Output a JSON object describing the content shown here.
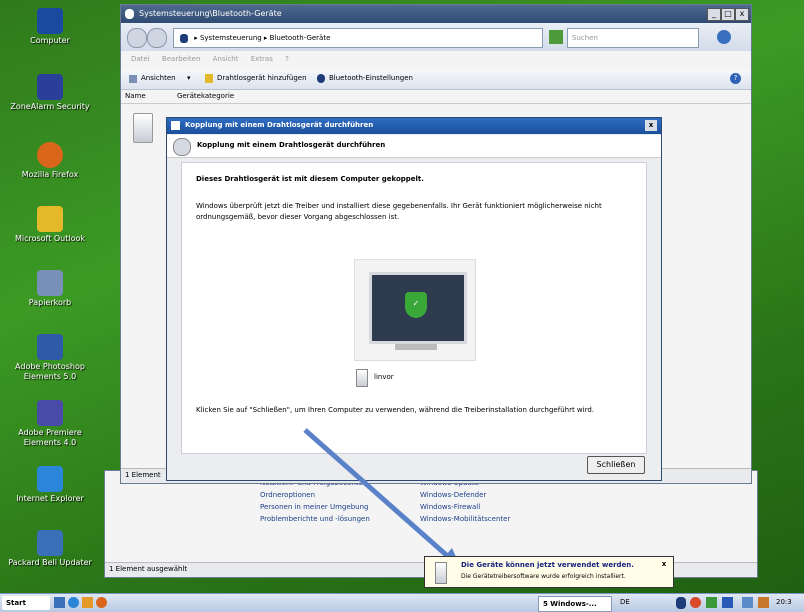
{
  "desktop_icons": [
    {
      "label": "Computer",
      "color": "#1a4aa0"
    },
    {
      "label": "ZoneAlarm Security",
      "color": "#2a3f99"
    },
    {
      "label": "Mozilla Firefox",
      "color": "#d9661a"
    },
    {
      "label": "Microsoft Outlook",
      "color": "#e3b92a"
    },
    {
      "label": "Papierkorb",
      "color": "#7890b8"
    },
    {
      "label": "Adobe Photoshop Elements 5.0",
      "color": "#2e5aa8"
    },
    {
      "label": "Adobe Premiere Elements 4.0",
      "color": "#4a4aa8"
    },
    {
      "label": "Internet Explorer",
      "color": "#2a86d8"
    },
    {
      "label": "Packard Bell Updater",
      "color": "#3a70b8"
    }
  ],
  "main_window": {
    "title": "Systemsteuerung\\Bluetooth-Geräte",
    "breadcrumb": "▸ Systemsteuerung ▸ Bluetooth-Geräte",
    "search_placeholder": "Suchen",
    "menu": [
      "Datei",
      "Bearbeiten",
      "Ansicht",
      "Extras",
      "?"
    ],
    "toolbar": {
      "views": "Ansichten",
      "add_device": "Drahtlosgerät hinzufügen",
      "bt_settings": "Bluetooth-Einstellungen"
    },
    "columns": [
      "Name",
      "Gerätekategorie"
    ],
    "status": "1 Element"
  },
  "bg_window": {
    "status": "1 Element ausgewählt",
    "links_left": [
      "Netzwerk- und Freigabecenter",
      "Ordneroptionen",
      "Personen in meiner Umgebung",
      "Problemberichte und -lösungen"
    ],
    "links_right": [
      "Windows Update",
      "Windows-Defender",
      "Windows-Firewall",
      "Windows-Mobilitätscenter"
    ]
  },
  "dialog": {
    "title": "Kopplung mit einem Drahtlosgerät durchführen",
    "header": "Kopplung mit einem Drahtlosgerät durchführen",
    "heading": "Dieses Drahtlosgerät ist mit diesem Computer gekoppelt.",
    "body": "Windows überprüft jetzt die Treiber und installiert diese gegebenenfalls. Ihr Gerät funktioniert möglicherweise nicht ordnungsgemäß, bevor dieser Vorgang abgeschlossen ist.",
    "device_name": "linvor",
    "footer_text": "Klicken Sie auf \"Schließen\", um Ihren Computer zu verwenden, während die Treiberinstallation durchgeführt wird.",
    "close_button": "Schließen"
  },
  "balloon": {
    "title": "Die Geräte können jetzt verwendet werden.",
    "text": "Die Gerätetreibersoftware wurde erfolgreich installiert."
  },
  "taskbar": {
    "start": "Start",
    "task": "5 Windows-...",
    "lang": "DE",
    "clock": "20:3"
  },
  "colors": {
    "accent": "#3c78c8",
    "arrow": "#5a82c8"
  }
}
